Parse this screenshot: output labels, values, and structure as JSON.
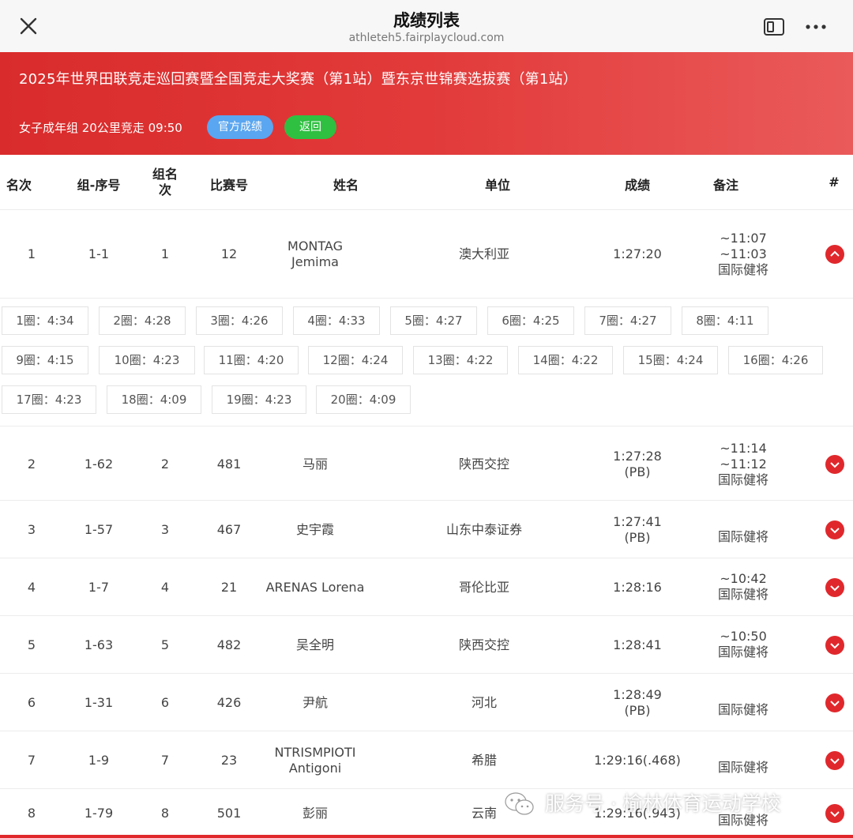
{
  "window": {
    "title": "成绩列表",
    "url": "athleteh5.fairplaycloud.com"
  },
  "banner": {
    "event": "2025年世界田联竞走巡回赛暨全国竞走大奖赛（第1站）暨东京世锦赛选拔赛（第1站）",
    "subtitle": "女子成年组 20公里竞走 09:50",
    "official_label": "官方成绩",
    "back_label": "返回"
  },
  "columns": {
    "rank": "名次",
    "group_seq": "组-序号",
    "group_rank_1": "组名",
    "group_rank_2": "次",
    "bib": "比赛号",
    "name": "姓名",
    "unit": "单位",
    "result": "成绩",
    "remark": "备注",
    "hash": "#"
  },
  "rows": [
    {
      "rank": "1",
      "group_seq": "1-1",
      "group_rank": "1",
      "bib": "12",
      "name1": "MONTAG",
      "name2": "Jemima",
      "unit": "澳大利亚",
      "result1": "1:27:20",
      "result2": "",
      "remark1": "~11:07",
      "remark2": "~11:03",
      "remark3": "国际健将"
    },
    {
      "rank": "2",
      "group_seq": "1-62",
      "group_rank": "2",
      "bib": "481",
      "name1": "马丽",
      "name2": "",
      "unit": "陕西交控",
      "result1": "1:27:28",
      "result2": "(PB)",
      "remark1": "~11:14",
      "remark2": "~11:12",
      "remark3": "国际健将"
    },
    {
      "rank": "3",
      "group_seq": "1-57",
      "group_rank": "3",
      "bib": "467",
      "name1": "史宇霞",
      "name2": "",
      "unit": "山东中泰证券",
      "result1": "1:27:41",
      "result2": "(PB)",
      "remark1": "",
      "remark2": "",
      "remark3": "国际健将"
    },
    {
      "rank": "4",
      "group_seq": "1-7",
      "group_rank": "4",
      "bib": "21",
      "name1": "ARENAS Lorena",
      "name2": "",
      "unit": "哥伦比亚",
      "result1": "1:28:16",
      "result2": "",
      "remark1": "~10:42",
      "remark2": "",
      "remark3": "国际健将"
    },
    {
      "rank": "5",
      "group_seq": "1-63",
      "group_rank": "5",
      "bib": "482",
      "name1": "吴全明",
      "name2": "",
      "unit": "陕西交控",
      "result1": "1:28:41",
      "result2": "",
      "remark1": "~10:50",
      "remark2": "",
      "remark3": "国际健将"
    },
    {
      "rank": "6",
      "group_seq": "1-31",
      "group_rank": "6",
      "bib": "426",
      "name1": "尹航",
      "name2": "",
      "unit": "河北",
      "result1": "1:28:49",
      "result2": "(PB)",
      "remark1": "",
      "remark2": "",
      "remark3": "国际健将"
    },
    {
      "rank": "7",
      "group_seq": "1-9",
      "group_rank": "7",
      "bib": "23",
      "name1": "NTRISMPIOTI",
      "name2": "Antigoni",
      "unit": "希腊",
      "result1": "1:29:16(.468)",
      "result2": "",
      "remark1": "",
      "remark2": "",
      "remark3": "国际健将"
    },
    {
      "rank": "8",
      "group_seq": "1-79",
      "group_rank": "8",
      "bib": "501",
      "name1": "彭丽",
      "name2": "",
      "unit": "云南",
      "result1": "1:29:16(.943)",
      "result2": "",
      "remark1": "",
      "remark2": "",
      "remark3": "国际健将"
    }
  ],
  "laps": [
    "1圈：4:34",
    "2圈：4:28",
    "3圈：4:26",
    "4圈：4:33",
    "5圈：4:27",
    "6圈：4:25",
    "7圈：4:27",
    "8圈：4:11",
    "9圈：4:15",
    "10圈：4:23",
    "11圈：4:20",
    "12圈：4:24",
    "13圈：4:22",
    "14圈：4:22",
    "15圈：4:24",
    "16圈：4:26",
    "17圈：4:23",
    "18圈：4:09",
    "19圈：4:23",
    "20圈：4:09"
  ],
  "watermark": "服务号 · 榆林体育运动学校",
  "colors": {
    "accent": "#e0282c",
    "official": "#5aa6f0",
    "back": "#2fbf41"
  },
  "icons": [
    "close-icon",
    "split-view-icon",
    "more-icon",
    "chevron-toggle-icon",
    "wechat-icon"
  ]
}
